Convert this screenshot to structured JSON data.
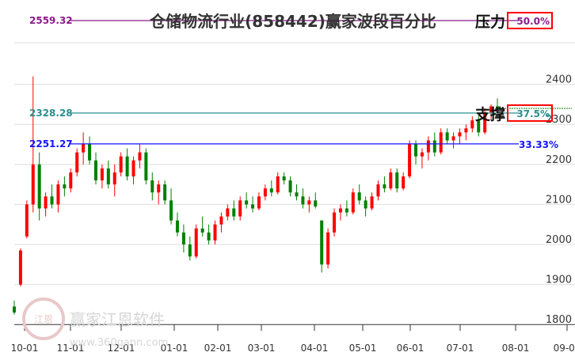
{
  "chart_data": {
    "type": "candlestick",
    "title": "仓储物流行业(858442)赢家波段百分比",
    "ylim": [
      1800,
      2559.32
    ],
    "y_ticks": [
      1800,
      1900,
      2000,
      2100,
      2200,
      2300,
      2400
    ],
    "x_ticks": [
      "10-01",
      "11-01",
      "12-01",
      "01-01",
      "02-01",
      "03-01",
      "04-01",
      "05-01",
      "06-01",
      "07-01",
      "08-01",
      "09-01"
    ],
    "levels": [
      {
        "value": 2559.32,
        "label": "2559.32",
        "pct": "50.0%",
        "tag": "压力",
        "color": "#8b1a8b",
        "boxed": true
      },
      {
        "value": 2328.28,
        "label": "2328.28",
        "pct": "37.5%",
        "tag": "支撑",
        "color": "#2a8f8f",
        "boxed": true
      },
      {
        "value": 2251.27,
        "label": "2251.27",
        "pct": "33.33%",
        "tag": "",
        "color": "#1515ff",
        "boxed": false
      }
    ],
    "up_color": "#ff0000",
    "down_color": "#008000",
    "ohlc": [
      [
        1845,
        1860,
        1825,
        1830
      ],
      [
        1900,
        1990,
        1895,
        1985
      ],
      [
        2020,
        2110,
        2015,
        2100
      ],
      [
        2100,
        2420,
        2080,
        2200
      ],
      [
        2200,
        2230,
        2060,
        2090
      ],
      [
        2090,
        2130,
        2070,
        2120
      ],
      [
        2120,
        2150,
        2090,
        2100
      ],
      [
        2100,
        2160,
        2080,
        2150
      ],
      [
        2150,
        2170,
        2120,
        2140
      ],
      [
        2140,
        2190,
        2130,
        2180
      ],
      [
        2180,
        2240,
        2170,
        2230
      ],
      [
        2230,
        2280,
        2200,
        2250
      ],
      [
        2250,
        2270,
        2200,
        2210
      ],
      [
        2210,
        2230,
        2150,
        2160
      ],
      [
        2160,
        2200,
        2140,
        2190
      ],
      [
        2190,
        2210,
        2140,
        2150
      ],
      [
        2150,
        2200,
        2120,
        2180
      ],
      [
        2180,
        2230,
        2170,
        2220
      ],
      [
        2220,
        2240,
        2160,
        2170
      ],
      [
        2170,
        2220,
        2150,
        2210
      ],
      [
        2210,
        2250,
        2190,
        2230
      ],
      [
        2230,
        2240,
        2150,
        2160
      ],
      [
        2160,
        2180,
        2110,
        2130
      ],
      [
        2130,
        2160,
        2100,
        2150
      ],
      [
        2150,
        2160,
        2100,
        2110
      ],
      [
        2110,
        2140,
        2050,
        2060
      ],
      [
        2060,
        2080,
        2020,
        2030
      ],
      [
        2030,
        2050,
        1980,
        2000
      ],
      [
        2000,
        2020,
        1960,
        1970
      ],
      [
        1970,
        2050,
        1965,
        2040
      ],
      [
        2040,
        2070,
        2020,
        2030
      ],
      [
        2030,
        2050,
        2000,
        2010
      ],
      [
        2010,
        2060,
        2000,
        2050
      ],
      [
        2050,
        2080,
        2030,
        2070
      ],
      [
        2070,
        2100,
        2060,
        2090
      ],
      [
        2090,
        2110,
        2060,
        2070
      ],
      [
        2070,
        2120,
        2060,
        2110
      ],
      [
        2110,
        2130,
        2090,
        2100
      ],
      [
        2100,
        2120,
        2080,
        2090
      ],
      [
        2090,
        2130,
        2085,
        2120
      ],
      [
        2120,
        2150,
        2110,
        2140
      ],
      [
        2140,
        2160,
        2120,
        2130
      ],
      [
        2130,
        2180,
        2125,
        2170
      ],
      [
        2170,
        2180,
        2150,
        2160
      ],
      [
        2160,
        2170,
        2120,
        2130
      ],
      [
        2130,
        2150,
        2110,
        2120
      ],
      [
        2120,
        2140,
        2090,
        2100
      ],
      [
        2100,
        2120,
        2080,
        2110
      ],
      [
        2110,
        2130,
        2090,
        2095
      ],
      [
        2060,
        2060,
        1930,
        1950
      ],
      [
        1950,
        2040,
        1940,
        2030
      ],
      [
        2030,
        2090,
        2020,
        2080
      ],
      [
        2080,
        2100,
        2060,
        2090
      ],
      [
        2090,
        2110,
        2070,
        2080
      ],
      [
        2080,
        2140,
        2075,
        2130
      ],
      [
        2130,
        2150,
        2100,
        2110
      ],
      [
        2110,
        2120,
        2070,
        2090
      ],
      [
        2090,
        2130,
        2085,
        2120
      ],
      [
        2120,
        2160,
        2110,
        2150
      ],
      [
        2150,
        2170,
        2130,
        2140
      ],
      [
        2140,
        2190,
        2135,
        2180
      ],
      [
        2180,
        2190,
        2130,
        2140
      ],
      [
        2140,
        2180,
        2135,
        2170
      ],
      [
        2170,
        2260,
        2165,
        2250
      ],
      [
        2250,
        2260,
        2200,
        2220
      ],
      [
        2220,
        2240,
        2190,
        2230
      ],
      [
        2230,
        2270,
        2210,
        2260
      ],
      [
        2260,
        2280,
        2220,
        2230
      ],
      [
        2230,
        2290,
        2225,
        2280
      ],
      [
        2280,
        2290,
        2250,
        2260
      ],
      [
        2260,
        2280,
        2240,
        2270
      ],
      [
        2270,
        2290,
        2250,
        2280
      ],
      [
        2280,
        2300,
        2260,
        2290
      ],
      [
        2290,
        2320,
        2280,
        2310
      ],
      [
        2310,
        2330,
        2270,
        2280
      ],
      [
        2280,
        2340,
        2275,
        2330
      ],
      [
        2330,
        2350,
        2310,
        2345
      ],
      [
        2345,
        2365,
        2330,
        2340
      ]
    ]
  },
  "watermark": {
    "name": "赢家江恩软件",
    "url": "www.360gann.com",
    "seal": "江恩恩家"
  }
}
